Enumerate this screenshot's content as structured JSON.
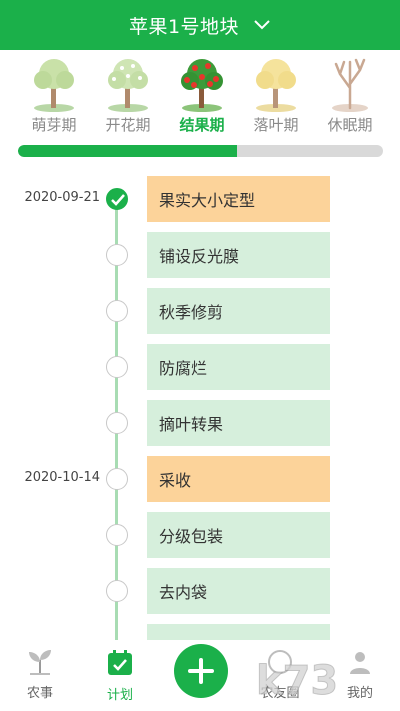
{
  "header": {
    "title": "苹果1号地块",
    "dropdown_icon": "chevron-down-icon"
  },
  "stages": [
    {
      "label": "萌芽期",
      "icon": "sprout-tree-icon",
      "active": false
    },
    {
      "label": "开花期",
      "icon": "flowering-tree-icon",
      "active": false
    },
    {
      "label": "结果期",
      "icon": "fruiting-tree-icon",
      "active": true
    },
    {
      "label": "落叶期",
      "icon": "yellow-leaf-tree-icon",
      "active": false
    },
    {
      "label": "休眠期",
      "icon": "bare-tree-icon",
      "active": false
    }
  ],
  "progress": {
    "fraction": 0.6
  },
  "timeline": [
    {
      "date": "2020-09-21",
      "task": "果实大小定型",
      "done": true,
      "highlight": true
    },
    {
      "date": "",
      "task": "铺设反光膜",
      "done": false,
      "highlight": false
    },
    {
      "date": "",
      "task": "秋季修剪",
      "done": false,
      "highlight": false
    },
    {
      "date": "",
      "task": "防腐烂",
      "done": false,
      "highlight": false
    },
    {
      "date": "",
      "task": "摘叶转果",
      "done": false,
      "highlight": false
    },
    {
      "date": "2020-10-14",
      "task": "采收",
      "done": false,
      "highlight": true
    },
    {
      "date": "",
      "task": "分级包装",
      "done": false,
      "highlight": false
    },
    {
      "date": "",
      "task": "去内袋",
      "done": false,
      "highlight": false
    },
    {
      "date": "",
      "task": "",
      "done": false,
      "highlight": false
    }
  ],
  "bottom_nav": {
    "farm": {
      "label": "农事",
      "icon": "seedling-icon"
    },
    "plan": {
      "label": "计划",
      "icon": "calendar-icon"
    },
    "add": {
      "icon": "plus-icon"
    },
    "circle": {
      "label": "农友圈"
    },
    "mine": {
      "label": "我的"
    }
  },
  "watermark": {
    "text": "k73"
  },
  "colors": {
    "primary": "#1bb04a",
    "card": "#d6efdc",
    "highlight_card": "#fcd39a",
    "timeline_line": "#a8dcb3"
  }
}
